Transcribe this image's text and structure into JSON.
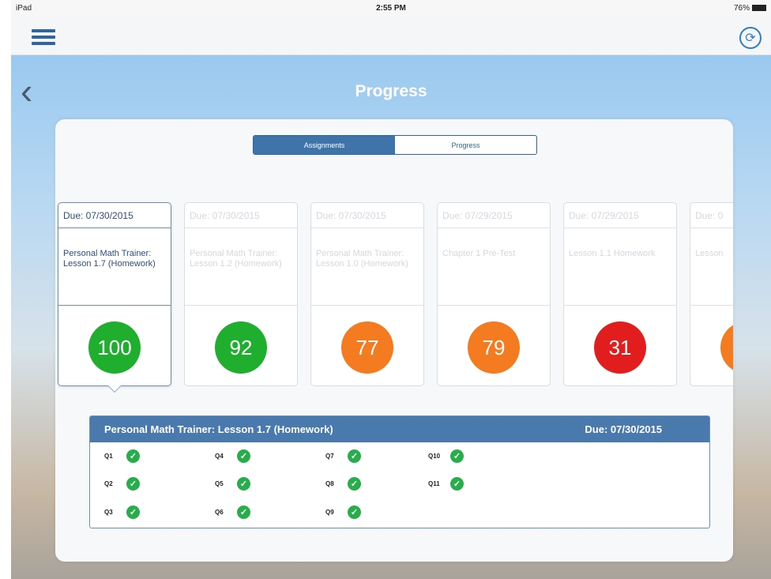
{
  "status_bar": {
    "device": "iPad",
    "time": "2:55 PM",
    "battery": "76%"
  },
  "nav": {
    "sync_icon": "sync-icon",
    "menu_icon": "hamburger-menu-icon"
  },
  "page": {
    "back_icon": "chevron-left-icon",
    "title": "Progress"
  },
  "segmented": {
    "tabs": [
      "Assignments",
      "Progress"
    ],
    "selected": "Assignments"
  },
  "assignments": [
    {
      "due": "Due: 07/30/2015",
      "name": "Personal Math Trainer: Lesson 1.7 (Homework)",
      "score": "100",
      "color": "#1fae2d"
    },
    {
      "due": "Due: 07/30/2015",
      "name": "Personal Math Trainer: Lesson 1.2 (Homework)",
      "score": "92",
      "color": "#1fae2d"
    },
    {
      "due": "Due: 07/30/2015",
      "name": "Personal Math Trainer: Lesson 1.0 (Homework)",
      "score": "77",
      "color": "#f47b20"
    },
    {
      "due": "Due: 07/29/2015",
      "name": "Chapter 1 Pre-Test",
      "score": "79",
      "color": "#f47b20"
    },
    {
      "due": "Due: 07/29/2015",
      "name": "Lesson 1.1 Homework",
      "score": "31",
      "color": "#e21d1d"
    },
    {
      "due": "Due: 0",
      "name": "Lesson",
      "score": "",
      "color": "#f47b20"
    }
  ],
  "detail": {
    "title": "Personal Math Trainer: Lesson 1.7 (Homework)",
    "due": "Due: 07/30/2015",
    "questions": [
      "Q1",
      "Q2",
      "Q3",
      "Q4",
      "Q5",
      "Q6",
      "Q7",
      "Q8",
      "Q9",
      "Q10",
      "Q11"
    ],
    "check_icon": "checkmark-icon",
    "check_color": "#27ad4a"
  }
}
